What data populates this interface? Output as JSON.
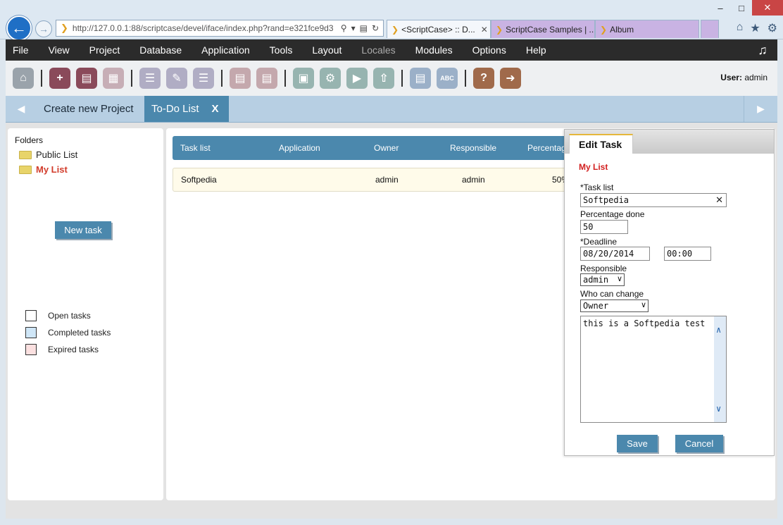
{
  "browser": {
    "url": "http://127.0.0.1:88/scriptcase/devel/iface/index.php?rand=e321fce9d3",
    "tabs": [
      {
        "label": "<ScriptCase> :: D..."
      },
      {
        "label": "ScriptCase Samples | ..."
      },
      {
        "label": "Album"
      }
    ]
  },
  "menu": {
    "items": [
      "File",
      "View",
      "Project",
      "Database",
      "Application",
      "Tools",
      "Layout",
      "Locales",
      "Modules",
      "Options",
      "Help"
    ]
  },
  "toolbar": {
    "user_label": "User:",
    "user_name": "admin"
  },
  "tabstrip": {
    "tab1": "Create new Project",
    "tab2": "To-Do List",
    "tab2_close": "X"
  },
  "sidebar": {
    "title": "Folders",
    "folders": [
      "Public List",
      "My List"
    ],
    "new_task": "New task",
    "legend": [
      "Open tasks",
      "Completed tasks",
      "Expired tasks"
    ]
  },
  "grid": {
    "headers": [
      "Task list",
      "Application",
      "Owner",
      "Responsible",
      "Percentag"
    ],
    "rows": [
      {
        "task": "Softpedia",
        "application": "",
        "owner": "admin",
        "responsible": "admin",
        "percent": "50%"
      }
    ]
  },
  "dialog": {
    "tab": "Edit Task",
    "subtitle": "My List",
    "task_label": "*Task list",
    "task_value": "Softpedia",
    "pct_label": "Percentage done",
    "pct_value": "50",
    "deadline_label": "*Deadline",
    "deadline_date": "08/20/2014",
    "deadline_time": "00:00",
    "responsible_label": "Responsible",
    "responsible_value": "admin",
    "who_label": "Who can change",
    "who_value": "Owner",
    "notes": "this is a Softpedia test",
    "save": "Save",
    "cancel": "Cancel"
  }
}
